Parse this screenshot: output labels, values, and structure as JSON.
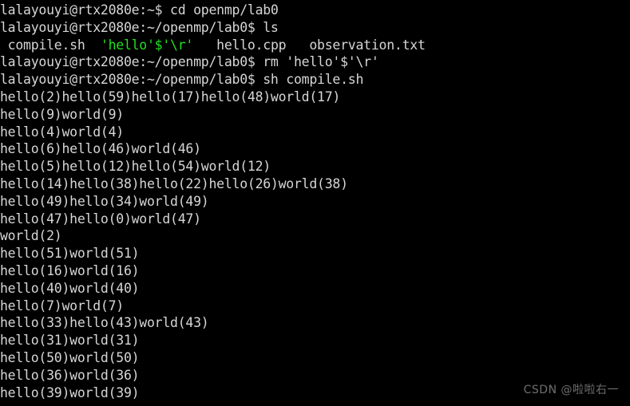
{
  "terminal": {
    "background_color": "#000000",
    "default_text_color": "#d6d6d6",
    "green_text_color": "#20e020",
    "user": "lalayouyi",
    "host": "rtx2080e",
    "lines": [
      {
        "id": "line-1",
        "type": "prompt-command",
        "text": "lalayouyi@rtx2080e:~$ cd openmp/lab0"
      },
      {
        "id": "line-2",
        "type": "prompt-command",
        "text": "lalayouyi@rtx2080e:~/openmp/lab0$ ls"
      },
      {
        "id": "line-3",
        "type": "ls-output",
        "segments": [
          {
            "text": " compile.sh  ",
            "color": "default"
          },
          {
            "text": "'hello'$'\\r'",
            "color": "green"
          },
          {
            "text": "   hello.cpp   observation.txt",
            "color": "default"
          }
        ]
      },
      {
        "id": "line-4",
        "type": "prompt-command",
        "text": "lalayouyi@rtx2080e:~/openmp/lab0$ rm 'hello'$'\\r'"
      },
      {
        "id": "line-5",
        "type": "prompt-command",
        "text": "lalayouyi@rtx2080e:~/openmp/lab0$ sh compile.sh"
      },
      {
        "id": "line-6",
        "type": "program-output",
        "text": "hello(2)hello(59)hello(17)hello(48)world(17)"
      },
      {
        "id": "line-7",
        "type": "program-output",
        "text": "hello(9)world(9)"
      },
      {
        "id": "line-8",
        "type": "program-output",
        "text": "hello(4)world(4)"
      },
      {
        "id": "line-9",
        "type": "program-output",
        "text": "hello(6)hello(46)world(46)"
      },
      {
        "id": "line-10",
        "type": "program-output",
        "text": "hello(5)hello(12)hello(54)world(12)"
      },
      {
        "id": "line-11",
        "type": "program-output",
        "text": "hello(14)hello(38)hello(22)hello(26)world(38)"
      },
      {
        "id": "line-12",
        "type": "program-output",
        "text": "hello(49)hello(34)world(49)"
      },
      {
        "id": "line-13",
        "type": "program-output",
        "text": "hello(47)hello(0)world(47)"
      },
      {
        "id": "line-14",
        "type": "program-output",
        "text": "world(2)"
      },
      {
        "id": "line-15",
        "type": "program-output",
        "text": "hello(51)world(51)"
      },
      {
        "id": "line-16",
        "type": "program-output",
        "text": "hello(16)world(16)"
      },
      {
        "id": "line-17",
        "type": "program-output",
        "text": "hello(40)world(40)"
      },
      {
        "id": "line-18",
        "type": "program-output",
        "text": "hello(7)world(7)"
      },
      {
        "id": "line-19",
        "type": "program-output",
        "text": "hello(33)hello(43)world(43)"
      },
      {
        "id": "line-20",
        "type": "program-output",
        "text": "hello(31)world(31)"
      },
      {
        "id": "line-21",
        "type": "program-output",
        "text": "hello(50)world(50)"
      },
      {
        "id": "line-22",
        "type": "program-output",
        "text": "hello(36)world(36)"
      },
      {
        "id": "line-23",
        "type": "program-output",
        "text": "hello(39)world(39)"
      }
    ]
  },
  "watermark": {
    "text": "CSDN @啦啦右一",
    "color": "#6e6e6e"
  }
}
